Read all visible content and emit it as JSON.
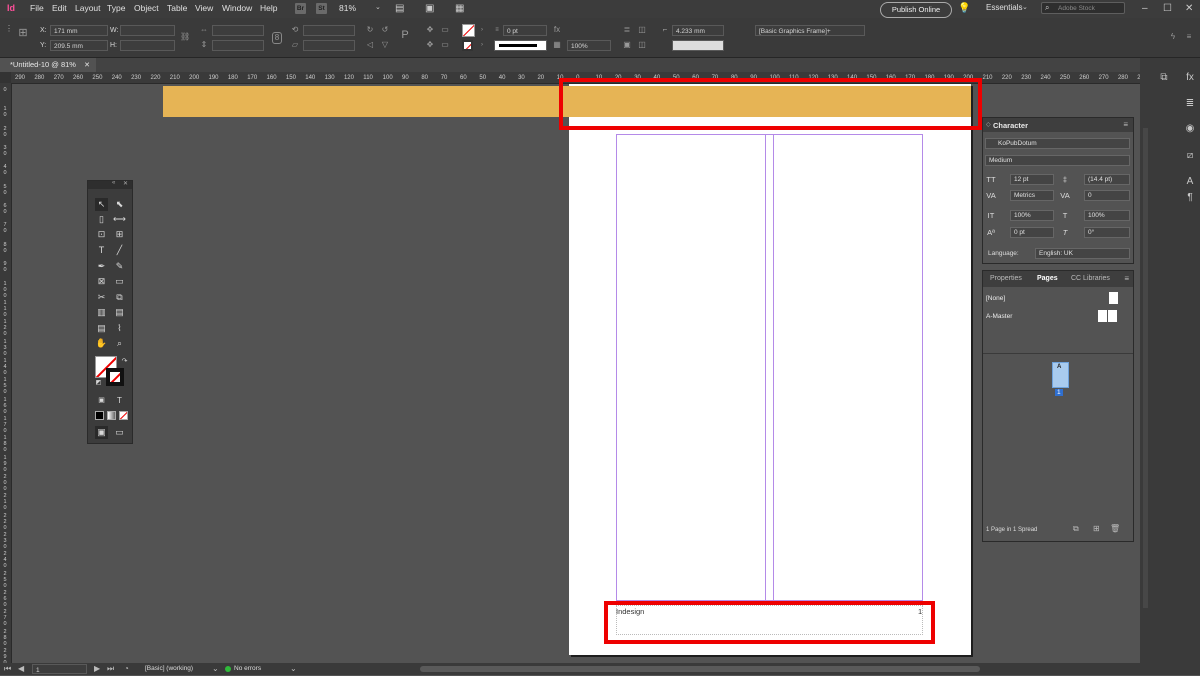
{
  "menubar": {
    "app_logo": "Id",
    "items": [
      "File",
      "Edit",
      "Layout",
      "Type",
      "Object",
      "Table",
      "View",
      "Window",
      "Help"
    ],
    "bridge": "Br",
    "stock": "St",
    "zoom": "81%",
    "publish": "Publish Online",
    "workspace": "Essentials",
    "search_placeholder": "Adobe Stock"
  },
  "control": {
    "x_label": "X:",
    "x_value": "171 mm",
    "y_label": "Y:",
    "y_value": "209.5 mm",
    "w_label": "W:",
    "h_label": "H:",
    "stroke_weight": "0 pt",
    "opacity": "100%",
    "dimension": "4.233 mm",
    "object_style": "[Basic Graphics Frame]+"
  },
  "document": {
    "tab_label": "*Untitled-10 @ 81%",
    "footer_text": "Indesign",
    "footer_page_number": "1"
  },
  "ruler": {
    "h_ticks": [
      "290",
      "280",
      "270",
      "260",
      "250",
      "240",
      "230",
      "220",
      "210",
      "200",
      "190",
      "180",
      "170",
      "160",
      "150",
      "140",
      "130",
      "120",
      "110",
      "100",
      "90",
      "80",
      "70",
      "60",
      "50",
      "40",
      "30",
      "20",
      "10",
      "0",
      "10",
      "20",
      "30",
      "40",
      "50",
      "60",
      "70",
      "80",
      "90",
      "100",
      "110",
      "120",
      "130",
      "140",
      "150",
      "160",
      "170",
      "180",
      "190",
      "200",
      "210",
      "220",
      "230",
      "240",
      "250",
      "260",
      "270",
      "280",
      "290"
    ],
    "v_ticks": [
      "0",
      "1 0",
      "2 0",
      "3 0",
      "4 0",
      "5 0",
      "6 0",
      "7 0",
      "8 0",
      "9 0",
      "1 0 0",
      "1 1 0",
      "1 2 0",
      "1 3 0",
      "1 4 0",
      "1 5 0",
      "1 6 0",
      "1 7 0",
      "1 8 0",
      "1 9 0",
      "2 0 0",
      "2 1 0",
      "2 2 0",
      "2 3 0",
      "2 4 0",
      "2 5 0",
      "2 6 0",
      "2 7 0",
      "2 8 0",
      "2 9 0"
    ]
  },
  "character_panel": {
    "title": "Character",
    "font_family": "KoPubDotum",
    "font_style": "Medium",
    "size": "12 pt",
    "leading": "(14.4 pt)",
    "kerning": "Metrics",
    "tracking": "0",
    "vertical_scale": "100%",
    "horizontal_scale": "100%",
    "baseline_shift": "0 pt",
    "skew": "0°",
    "language_label": "Language:",
    "language": "English: UK"
  },
  "pages_panel": {
    "tabs": [
      "Properties",
      "Pages",
      "CC Libraries"
    ],
    "none_master": "[None]",
    "a_master": "A-Master",
    "page_prefix": "A",
    "page_number": "1",
    "summary": "1 Page in 1 Spread"
  },
  "statusbar": {
    "page": "1",
    "style": "[Basic] (working)",
    "preflight": "No errors"
  },
  "colors": {
    "bleed_bar": "#e6b455",
    "highlight": "#ee0000",
    "margin": "#b48ae8"
  }
}
